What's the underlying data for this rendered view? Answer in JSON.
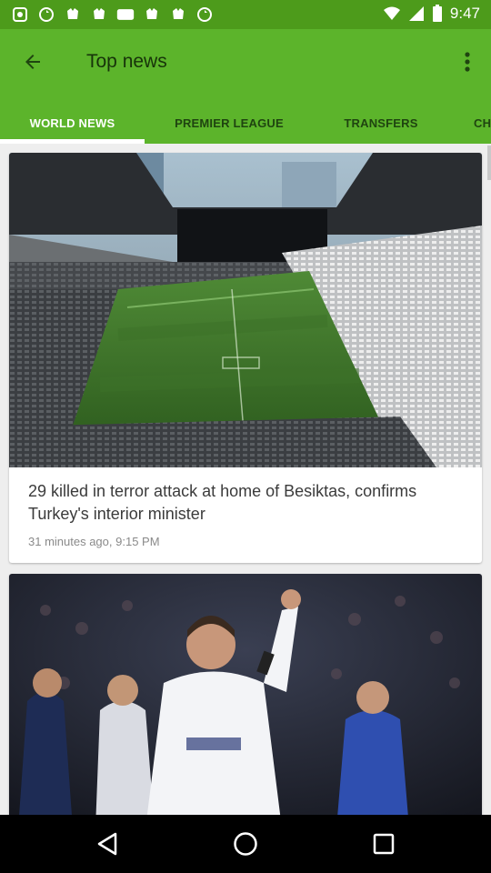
{
  "status_bar": {
    "time": "9:47",
    "left_icons": [
      "app-notification-icon",
      "sync-icon",
      "app-notification-icon",
      "app-notification-icon",
      "esc-icon",
      "app-notification-icon",
      "app-notification-icon",
      "sync-icon"
    ],
    "right_icons": [
      "wifi-icon",
      "signal-icon",
      "battery-icon"
    ]
  },
  "app_bar": {
    "title": "Top news",
    "back_icon": "arrow-back-icon",
    "overflow_icon": "more-vert-icon"
  },
  "tabs": [
    {
      "label": "WORLD NEWS",
      "active": true
    },
    {
      "label": "PREMIER LEAGUE",
      "active": false
    },
    {
      "label": "TRANSFERS",
      "active": false
    },
    {
      "label": "CH",
      "active": false
    }
  ],
  "articles": [
    {
      "image": "stadium-photo",
      "headline": "29 killed in terror attack at home of Besiktas, confirms Turkey's interior minister",
      "meta": "31 minutes ago, 9:15 PM"
    },
    {
      "image": "football-player-photo",
      "headline": "",
      "meta": ""
    }
  ],
  "nav_bar": {
    "icons": [
      "back-icon",
      "home-icon",
      "recents-icon"
    ]
  },
  "colors": {
    "status_bar": "#4d9b1b",
    "app_bar": "#5cb42b",
    "active_tab": "#ffffff",
    "inactive_tab": "#1f4410"
  }
}
